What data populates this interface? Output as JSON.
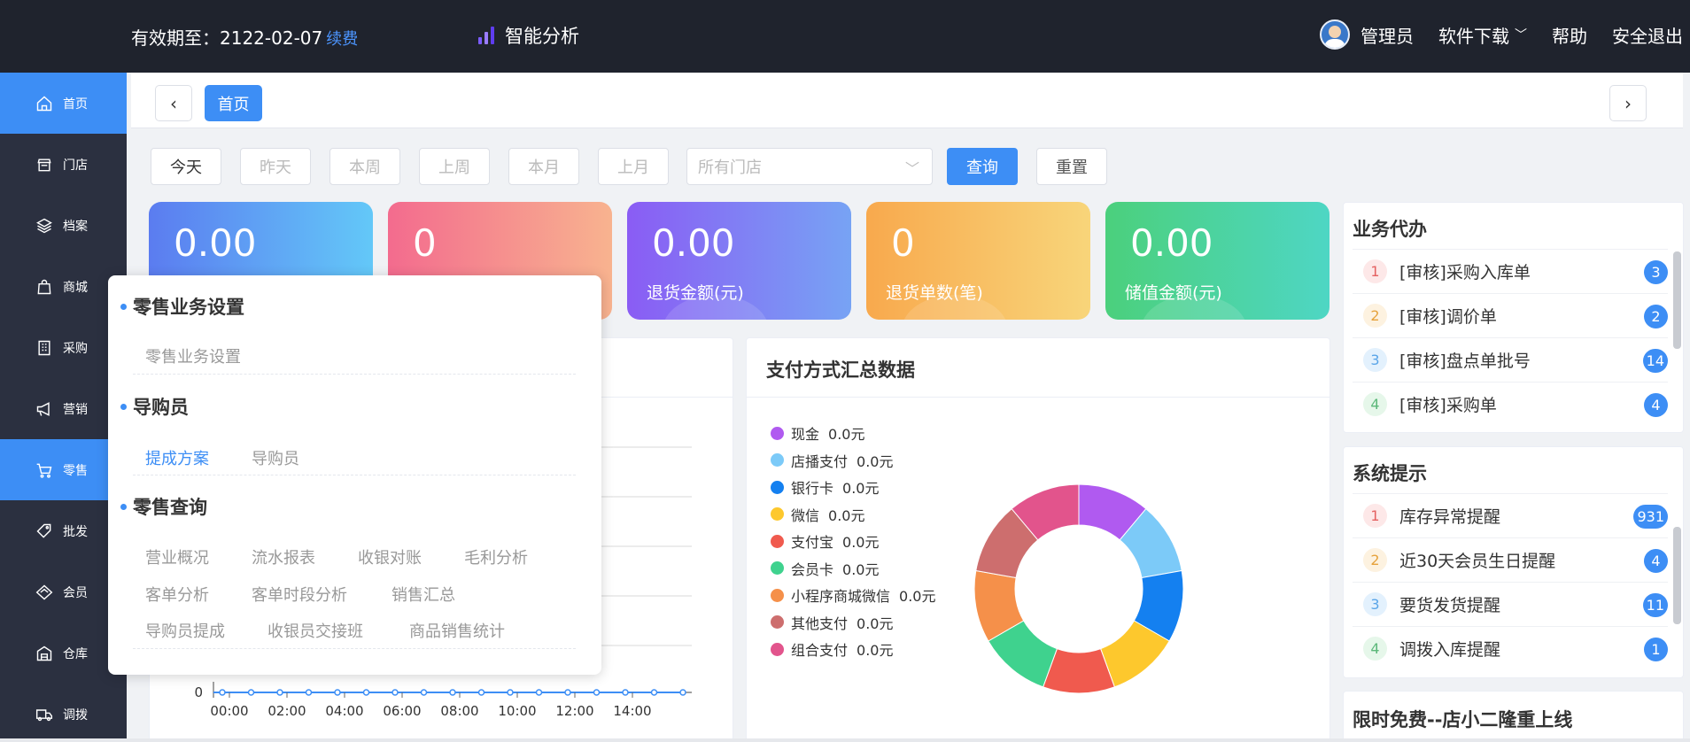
{
  "header": {
    "validity_label": "有效期至：2122-02-07",
    "renew": "续费",
    "brand": "智能分析",
    "admin": "管理员",
    "download": "软件下载",
    "help": "帮助",
    "logout": "安全退出"
  },
  "sidebar": {
    "items": [
      {
        "label": "首页",
        "icon": "home-icon"
      },
      {
        "label": "门店",
        "icon": "store-icon"
      },
      {
        "label": "档案",
        "icon": "layers-icon"
      },
      {
        "label": "商城",
        "icon": "bag-icon"
      },
      {
        "label": "采购",
        "icon": "building-icon"
      },
      {
        "label": "营销",
        "icon": "megaphone-icon"
      },
      {
        "label": "零售",
        "icon": "cart-icon"
      },
      {
        "label": "批发",
        "icon": "tag-icon"
      },
      {
        "label": "会员",
        "icon": "diamond-icon"
      },
      {
        "label": "仓库",
        "icon": "warehouse-icon"
      },
      {
        "label": "调拨",
        "icon": "truck-icon"
      }
    ],
    "active": "零售"
  },
  "breadcrumb": {
    "tag": "首页"
  },
  "filters": {
    "buttons": [
      "今天",
      "昨天",
      "本周",
      "上周",
      "本月",
      "上月"
    ],
    "store_placeholder": "所有门店",
    "query": "查询",
    "reset": "重置"
  },
  "stats": [
    {
      "value": "0.00",
      "label": ""
    },
    {
      "value": "0",
      "label": ""
    },
    {
      "value": "0.00",
      "label": "退货金额(元)"
    },
    {
      "value": "0",
      "label": "退货单数(笔)"
    },
    {
      "value": "0.00",
      "label": "储值金额(元)"
    }
  ],
  "trend_chart": {
    "y_zero": "0",
    "x_ticks": [
      "00:00",
      "02:00",
      "04:00",
      "06:00",
      "08:00",
      "10:00",
      "12:00",
      "14:00"
    ]
  },
  "payment": {
    "title": "支付方式汇总数据",
    "items": [
      {
        "name": "现金",
        "value": "0.0元",
        "color": "#b05af0"
      },
      {
        "name": "店播支付",
        "value": "0.0元",
        "color": "#7ccaf8"
      },
      {
        "name": "银行卡",
        "value": "0.0元",
        "color": "#1480f0"
      },
      {
        "name": "微信",
        "value": "0.0元",
        "color": "#fdc82d"
      },
      {
        "name": "支付宝",
        "value": "0.0元",
        "color": "#f05a4e"
      },
      {
        "name": "会员卡",
        "value": "0.0元",
        "color": "#3fd28e"
      },
      {
        "name": "小程序商城微信",
        "value": "0.0元",
        "color": "#f5904a"
      },
      {
        "name": "其他支付",
        "value": "0.0元",
        "color": "#cd6e6e"
      },
      {
        "name": "组合支付",
        "value": "0.0元",
        "color": "#e2548c"
      }
    ]
  },
  "todo": {
    "title": "业务代办",
    "items": [
      {
        "no": "1",
        "text": "[审核]采购入库单",
        "count": "3"
      },
      {
        "no": "2",
        "text": "[审核]调价单",
        "count": "2"
      },
      {
        "no": "3",
        "text": "[审核]盘点单批号",
        "count": "14"
      },
      {
        "no": "4",
        "text": "[审核]采购单",
        "count": "4"
      }
    ]
  },
  "tips": {
    "title": "系统提示",
    "items": [
      {
        "no": "1",
        "text": "库存异常提醒",
        "count": "931"
      },
      {
        "no": "2",
        "text": "近30天会员生日提醒",
        "count": "4"
      },
      {
        "no": "3",
        "text": "要货发货提醒",
        "count": "11"
      },
      {
        "no": "4",
        "text": "调拨入库提醒",
        "count": "1"
      }
    ]
  },
  "promo": {
    "title": "限时免费--店小二隆重上线"
  },
  "popup": {
    "sections": [
      {
        "title": "零售业务设置",
        "links": [
          "零售业务设置"
        ]
      },
      {
        "title": "导购员",
        "links": [
          "提成方案",
          "导购员"
        ]
      },
      {
        "title": "零售查询",
        "links": [
          "营业概况",
          "流水报表",
          "收银对账",
          "毛利分析",
          "客单分析",
          "客单时段分析",
          "销售汇总",
          "导购员提成",
          "收银员交接班",
          "商品销售统计"
        ]
      }
    ]
  }
}
